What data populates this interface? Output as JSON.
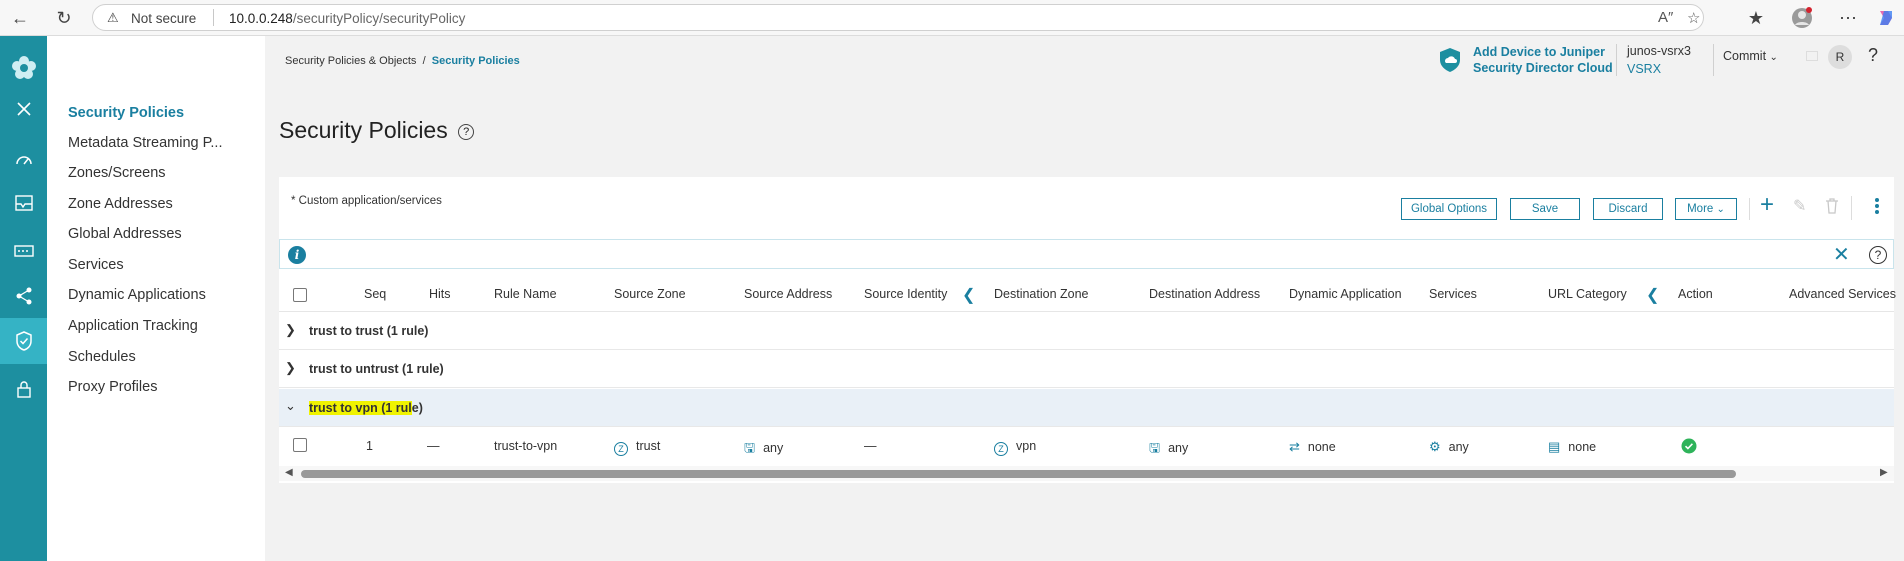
{
  "browser": {
    "not_secure": "Not secure",
    "url_host": "10.0.0.248",
    "url_path": "/securityPolicy/securityPolicy"
  },
  "nav": {
    "items": [
      {
        "label": "Security Policies",
        "active": true
      },
      {
        "label": "Metadata Streaming P..."
      },
      {
        "label": "Zones/Screens"
      },
      {
        "label": "Zone Addresses"
      },
      {
        "label": "Global Addresses"
      },
      {
        "label": "Services"
      },
      {
        "label": "Dynamic Applications"
      },
      {
        "label": "Application Tracking"
      },
      {
        "label": "Schedules"
      },
      {
        "label": "Proxy Profiles"
      }
    ]
  },
  "header": {
    "breadcrumb_root": "Security Policies & Objects",
    "breadcrumb_sep": "/",
    "breadcrumb_current": "Security Policies",
    "cloud_line1": "Add Device to Juniper",
    "cloud_line2": "Security Director Cloud",
    "device_name": "junos-vsrx3",
    "device_type": "VSRX",
    "commit_label": "Commit",
    "avatar_initial": "R",
    "help": "?"
  },
  "page": {
    "title": "Security Policies",
    "note": "* Custom application/services"
  },
  "toolbar": {
    "global_options": "Global Options",
    "save": "Save",
    "discard": "Discard",
    "more": "More"
  },
  "grid": {
    "columns": [
      "Seq",
      "Hits",
      "Rule Name",
      "Source Zone",
      "Source Address",
      "Source Identity",
      "Destination Zone",
      "Destination Address",
      "Dynamic Application",
      "Services",
      "URL Category",
      "Action",
      "Advanced Services"
    ],
    "groups": [
      {
        "label": "trust to trust (1 rule)",
        "expanded": false
      },
      {
        "label": "trust to untrust (1 rule)",
        "expanded": false
      },
      {
        "label_highlight": "trust to vpn (1 rul",
        "label_rest": "e)",
        "expanded": true
      }
    ],
    "rows": [
      {
        "seq": "1",
        "hits": "—",
        "rule_name": "trust-to-vpn",
        "source_zone": "trust",
        "source_address": "any",
        "source_identity": "—",
        "destination_zone": "vpn",
        "destination_address": "any",
        "dynamic_application": "none",
        "services": "any",
        "url_category": "none",
        "action": "permit"
      }
    ]
  },
  "colors": {
    "accent": "#1a7fa0",
    "rail": "#1d8fa0",
    "rail_active": "#35b3c5",
    "highlight": "#f0f300",
    "permit": "#2eb35a"
  }
}
